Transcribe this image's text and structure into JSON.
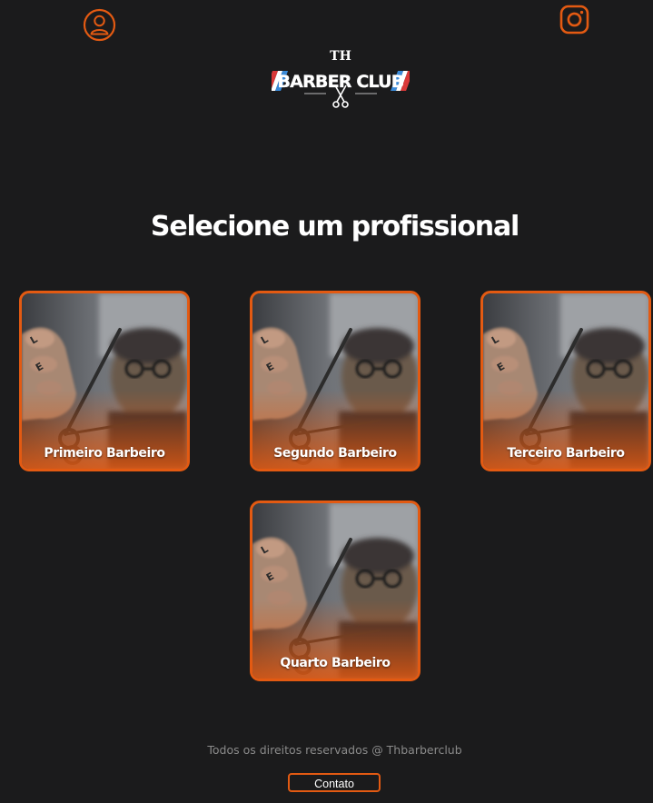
{
  "header": {
    "profile_icon": "user-icon",
    "instagram_icon": "instagram-icon",
    "logo": {
      "top_text": "TH",
      "main_text": "BARBER CLUB",
      "emblem": "scissors-icon"
    }
  },
  "main": {
    "title": "Selecione um profissional",
    "professionals": [
      {
        "label": "Primeiro Barbeiro"
      },
      {
        "label": "Segundo Barbeiro"
      },
      {
        "label": "Terceiro Barbeiro"
      },
      {
        "label": "Quarto Barbeiro"
      }
    ]
  },
  "footer": {
    "copyright": "Todos os direitos reservados @ Thbarberclub",
    "contact_label": "Contato"
  },
  "colors": {
    "background": "#1b1b1c",
    "accent": "#e35a12",
    "text": "#ffffff",
    "muted_text": "#8a8a8a"
  }
}
